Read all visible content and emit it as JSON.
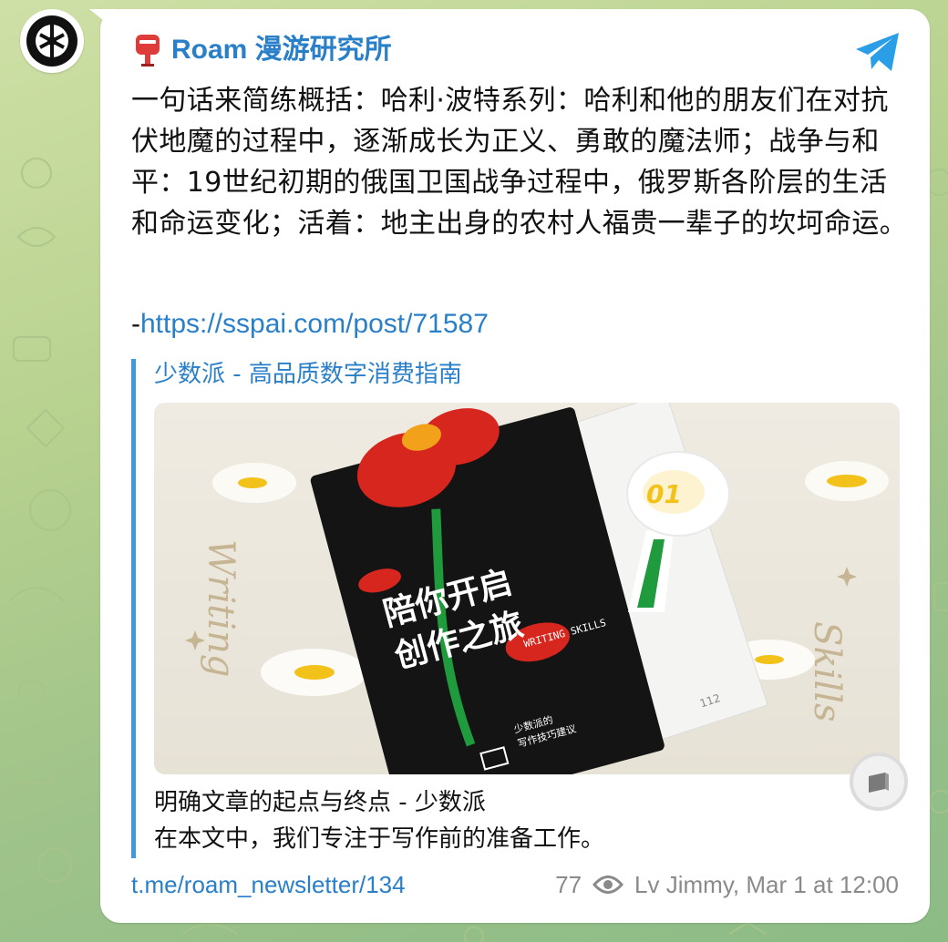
{
  "channel": {
    "name": "Roam 漫游研究所"
  },
  "message": {
    "text": "一句话来简练概括：哈利·波特系列：哈利和他的朋友们在对抗伏地魔的过程中，逐渐成长为正义、勇敢的魔法师；战争与和平：19世纪初期的俄国卫国战争过程中，俄罗斯各阶层的生活和命运变化；活着：地主出身的农村人福贵一辈子的坎坷命运。",
    "link_prefix": "-",
    "link": "https://sspai.com/post/71587"
  },
  "preview": {
    "site_name": "少数派 - 高品质数字消费指南",
    "image": {
      "book_title_line1": "陪你开启",
      "book_title_line2": "创作之旅",
      "book_subtitle_line1": "少数派的",
      "book_subtitle_line2": "写作技巧建议",
      "badge_number": "01",
      "left_script": "Writing",
      "right_script": "Skills",
      "page_number": "112",
      "book_tag": "WRITING SKILLS"
    },
    "title": "明确文章的起点与终点 - 少数派",
    "description": "在本文中，我们专注于写作前的准备工作。"
  },
  "footer": {
    "post_link": "t.me/roam_newsletter/134",
    "views": "77",
    "author_time": "Lv Jimmy, Mar 1 at 12:00"
  },
  "colors": {
    "link": "#2a7fc9",
    "accent_bar": "#3d9ae0",
    "meta_gray": "#8a8a8a",
    "telegram_blue": "#2a9ee6"
  },
  "icons": [
    "postbox-icon",
    "telegram-share-icon",
    "eye-icon",
    "instant-view-icon",
    "channel-avatar"
  ]
}
